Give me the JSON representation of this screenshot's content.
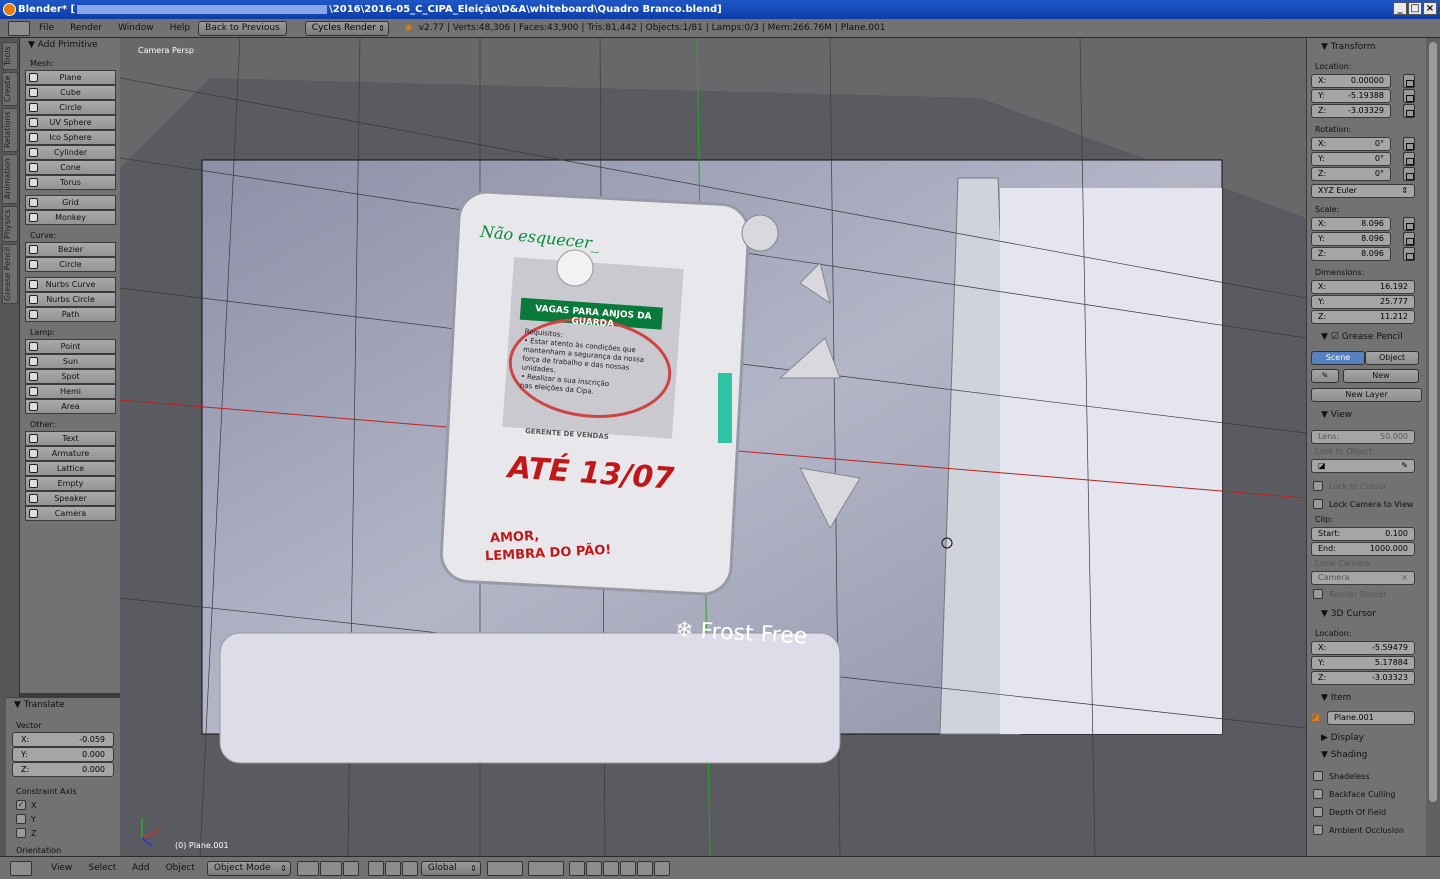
{
  "titlebar": {
    "app": "Blender*",
    "path_start": "[",
    "path": "\\2016\\2016-05_C_CIPA_Eleição\\D&A\\whiteboard\\Quadro Branco.blend]"
  },
  "infobar": {
    "menus": [
      "File",
      "Render",
      "Window",
      "Help"
    ],
    "back_button": "Back to Previous",
    "engine": "Cycles Render",
    "stats": "v2.77 | Verts:48,306 | Faces:43,900 | Tris:81,442 | Objects:1/81 | Lamps:0/3 | Mem:266.76M | Plane.001"
  },
  "lefttabs": [
    "Tools",
    "Create",
    "Relations",
    "Animation",
    "Physics",
    "Grease Pencil"
  ],
  "toolshelf": {
    "title": "Add Primitive",
    "groups": [
      {
        "name": "Mesh:",
        "items": [
          "Plane",
          "Cube",
          "Circle",
          "UV Sphere",
          "Ico Sphere",
          "Cylinder",
          "Cone",
          "Torus"
        ]
      },
      {
        "name": "",
        "items": [
          "Grid",
          "Monkey"
        ]
      },
      {
        "name": "Curve:",
        "items": [
          "Bezier",
          "Circle"
        ]
      },
      {
        "name": "",
        "items": [
          "Nurbs Curve",
          "Nurbs Circle",
          "Path"
        ]
      },
      {
        "name": "Lamp:",
        "items": [
          "Point",
          "Sun",
          "Spot",
          "Hemi",
          "Area"
        ]
      },
      {
        "name": "Other:",
        "items": [
          "Text",
          "Armature",
          "Lattice",
          "Empty",
          "Speaker",
          "Camera"
        ]
      }
    ]
  },
  "operator": {
    "title": "Translate",
    "vector_label": "Vector",
    "vector": [
      {
        "axis": "X:",
        "value": "-0.059"
      },
      {
        "axis": "Y:",
        "value": "0.000"
      },
      {
        "axis": "Z:",
        "value": "0.000"
      }
    ],
    "constraint_label": "Constraint Axis",
    "axes": [
      "X",
      "Y",
      "Z"
    ],
    "orientation_label": "Orientation"
  },
  "viewport": {
    "label": "Camera Persp",
    "object_label": "(0) Plane.001",
    "note_title": "Não esquecer_",
    "note_banner": "VAGAS PARA ANJOS DA GUARDA",
    "note_req": "Requisitos:",
    "note_line1": "• Estar atento às condições que",
    "note_line2": "mantenham a segurança da nossa",
    "note_line3": "força de trabalho e das nossas",
    "note_line4": "unidades.",
    "note_line5": "• Realizar a sua inscrição",
    "note_line6": "nas eleições da Cipa.",
    "note_sig": "GERENTE DE VENDAS",
    "note_date": "ATÉ 13/07",
    "note_love1": "AMOR,",
    "note_love2": "LEMBRA DO PÃO!",
    "fridge_label": "Frost Free"
  },
  "props": {
    "transform_title": "Transform",
    "location_label": "Location:",
    "location": [
      {
        "axis": "X:",
        "value": "0.00000"
      },
      {
        "axis": "Y:",
        "value": "-5.19388"
      },
      {
        "axis": "Z:",
        "value": "-3.03329"
      }
    ],
    "rotation_label": "Rotation:",
    "rotation": [
      {
        "axis": "X:",
        "value": "0°"
      },
      {
        "axis": "Y:",
        "value": "0°"
      },
      {
        "axis": "Z:",
        "value": "0°"
      }
    ],
    "rot_mode": "XYZ Euler",
    "scale_label": "Scale:",
    "scale": [
      {
        "axis": "X:",
        "value": "8.096"
      },
      {
        "axis": "Y:",
        "value": "8.096"
      },
      {
        "axis": "Z:",
        "value": "8.096"
      }
    ],
    "dimensions_label": "Dimensions:",
    "dimensions": [
      {
        "axis": "X:",
        "value": "16.192"
      },
      {
        "axis": "Y:",
        "value": "25.777"
      },
      {
        "axis": "Z:",
        "value": "11.212"
      }
    ],
    "gp_title": "Grease Pencil",
    "gp_scene": "Scene",
    "gp_object": "Object",
    "gp_new": "New",
    "gp_new_layer": "New Layer",
    "view_title": "View",
    "lens_label": "Lens:",
    "lens_value": "50.000",
    "lock_obj_label": "Lock to Object:",
    "lock_cursor": "Lock to Cursor",
    "lock_camera": "Lock Camera to View",
    "clip_label": "Clip:",
    "clip_start_label": "Start:",
    "clip_start": "0.100",
    "clip_end_label": "End:",
    "clip_end": "1000.000",
    "local_camera_label": "Local Camera:",
    "local_camera": "Camera",
    "render_border": "Render Border",
    "cursor_title": "3D Cursor",
    "cursor_location_label": "Location:",
    "cursor": [
      {
        "axis": "X:",
        "value": "-5.59479"
      },
      {
        "axis": "Y:",
        "value": "5.17884"
      },
      {
        "axis": "Z:",
        "value": "-3.03323"
      }
    ],
    "item_title": "Item",
    "item_name": "Plane.001",
    "display_title": "Display",
    "shading_title": "Shading",
    "shading": [
      "Shadeless",
      "Backface Culling",
      "Depth Of Field",
      "Ambient Occlusion"
    ]
  },
  "bottombar": {
    "view": "View",
    "select": "Select",
    "add": "Add",
    "object": "Object",
    "mode": "Object Mode",
    "orientation": "Global"
  }
}
